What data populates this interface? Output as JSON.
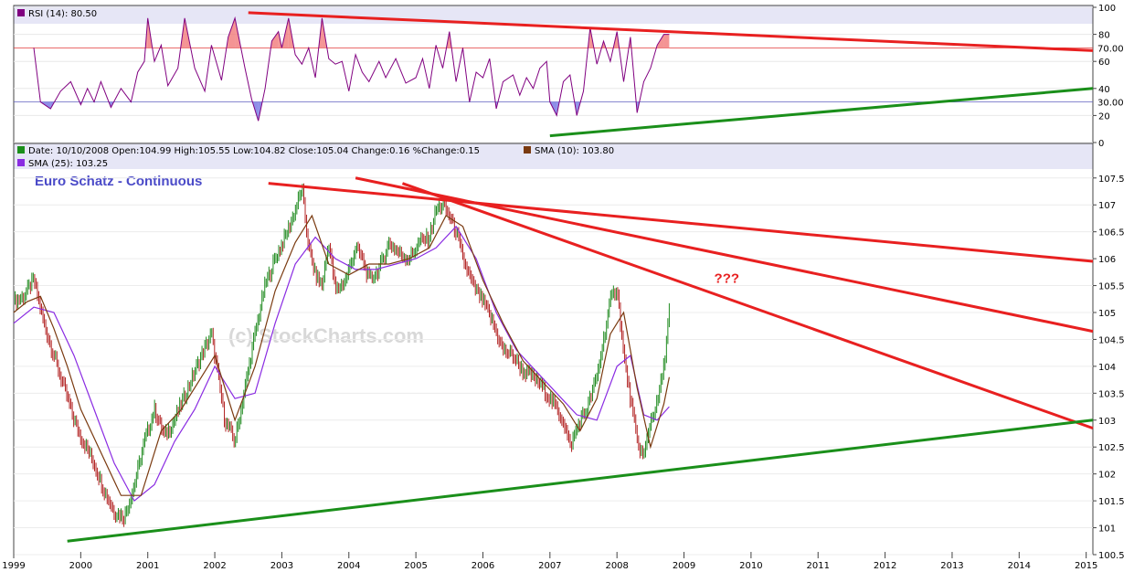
{
  "chart_data": [
    {
      "type": "line",
      "panel": "rsi",
      "legend": [
        {
          "label": "RSI (14): 80.50",
          "color": "#800080"
        }
      ],
      "ylim": [
        0,
        100
      ],
      "yticks": [
        0,
        20,
        40,
        60,
        80,
        100
      ],
      "overbought": {
        "label": "70.00",
        "value": 70,
        "color": "#e23a3a"
      },
      "oversold": {
        "label": "30.00",
        "value": 30,
        "color": "#6060c0"
      },
      "xlim": [
        1999.0,
        2015.1
      ],
      "series": [
        {
          "color": "#800080",
          "x": [
            1999.3,
            1999.4,
            1999.55,
            1999.7,
            1999.85,
            2000.0,
            2000.1,
            2000.2,
            2000.3,
            2000.45,
            2000.6,
            2000.75,
            2000.85,
            2000.95,
            2001.0,
            2001.1,
            2001.2,
            2001.3,
            2001.45,
            2001.55,
            2001.7,
            2001.85,
            2001.95,
            2002.1,
            2002.2,
            2002.3,
            2002.45,
            2002.55,
            2002.65,
            2002.75,
            2002.85,
            2002.95,
            2003.0,
            2003.1,
            2003.2,
            2003.3,
            2003.4,
            2003.5,
            2003.6,
            2003.7,
            2003.8,
            2003.9,
            2004.0,
            2004.1,
            2004.2,
            2004.3,
            2004.45,
            2004.55,
            2004.7,
            2004.85,
            2005.0,
            2005.1,
            2005.2,
            2005.3,
            2005.4,
            2005.5,
            2005.6,
            2005.7,
            2005.8,
            2005.9,
            2006.0,
            2006.1,
            2006.2,
            2006.3,
            2006.45,
            2006.55,
            2006.65,
            2006.75,
            2006.85,
            2006.95,
            2007.0,
            2007.1,
            2007.2,
            2007.3,
            2007.4,
            2007.5,
            2007.6,
            2007.7,
            2007.8,
            2007.9,
            2008.0,
            2008.1,
            2008.2,
            2008.3,
            2008.4,
            2008.5,
            2008.6,
            2008.7,
            2008.78
          ],
          "y": [
            70,
            30,
            25,
            38,
            45,
            28,
            40,
            30,
            45,
            26,
            40,
            30,
            52,
            60,
            92,
            60,
            72,
            42,
            55,
            92,
            55,
            38,
            72,
            46,
            78,
            92,
            55,
            32,
            16,
            40,
            75,
            82,
            70,
            92,
            65,
            58,
            70,
            48,
            92,
            62,
            58,
            60,
            38,
            65,
            52,
            45,
            60,
            48,
            62,
            44,
            48,
            62,
            40,
            72,
            55,
            82,
            45,
            70,
            30,
            52,
            48,
            62,
            25,
            45,
            50,
            35,
            48,
            40,
            55,
            60,
            30,
            20,
            45,
            50,
            20,
            38,
            85,
            58,
            75,
            60,
            82,
            45,
            78,
            22,
            45,
            55,
            72,
            80,
            80
          ]
        }
      ],
      "annotations": [
        {
          "type": "trendline",
          "color": "#e82020",
          "from": [
            2002.5,
            96
          ],
          "to": [
            2015.1,
            68
          ]
        },
        {
          "type": "trendline",
          "color": "#1a8f1a",
          "from": [
            2007.0,
            5
          ],
          "to": [
            2015.1,
            40
          ]
        }
      ]
    },
    {
      "type": "candlestick",
      "panel": "price",
      "title": "Euro Schatz - Continuous",
      "watermark": "(c) StockCharts.com",
      "legend": [
        {
          "label": "Date: 10/10/2008  Open:104.99  High:105.55  Low:104.82  Close:105.04  Change:0.16  %Change:0.15",
          "color": "#1a8f1a"
        },
        {
          "label": "SMA (10): 103.80",
          "color": "#7a3a10"
        },
        {
          "label": "SMA (25): 103.25",
          "color": "#8a2be2"
        }
      ],
      "ylim": [
        100.5,
        107.7
      ],
      "yticks": [
        100.5,
        101,
        101.5,
        102,
        102.5,
        103,
        103.5,
        104,
        104.5,
        105,
        105.5,
        106,
        106.5,
        107,
        107.5
      ],
      "xlim": [
        1999.0,
        2015.1
      ],
      "xticks": [
        "1999",
        "2000",
        "2001",
        "2002",
        "2003",
        "2004",
        "2005",
        "2006",
        "2007",
        "2008",
        "2009",
        "2010",
        "2011",
        "2012",
        "2013",
        "2014",
        "2015"
      ],
      "series": [
        {
          "name": "Price",
          "color": "#2a7a2a",
          "x": [
            1999.0,
            1999.15,
            1999.3,
            1999.45,
            1999.6,
            1999.75,
            1999.9,
            2000.0,
            2000.2,
            2000.35,
            2000.5,
            2000.65,
            2000.8,
            2000.95,
            2001.1,
            2001.25,
            2001.4,
            2001.6,
            2001.8,
            2001.95,
            2002.05,
            2002.15,
            2002.3,
            2002.45,
            2002.6,
            2002.75,
            2002.9,
            2003.05,
            2003.2,
            2003.3,
            2003.4,
            2003.5,
            2003.6,
            2003.7,
            2003.8,
            2003.95,
            2004.1,
            2004.2,
            2004.3,
            2004.45,
            2004.6,
            2004.75,
            2004.9,
            2005.05,
            2005.2,
            2005.3,
            2005.4,
            2005.5,
            2005.6,
            2005.7,
            2005.85,
            2006.0,
            2006.15,
            2006.3,
            2006.45,
            2006.6,
            2006.75,
            2006.9,
            2007.0,
            2007.1,
            2007.2,
            2007.3,
            2007.45,
            2007.55,
            2007.7,
            2007.8,
            2007.9,
            2008.0,
            2008.1,
            2008.2,
            2008.3,
            2008.4,
            2008.5,
            2008.6,
            2008.7,
            2008.78
          ],
          "y": [
            105.2,
            105.3,
            105.6,
            104.8,
            104.2,
            103.6,
            103.0,
            102.7,
            102.2,
            101.7,
            101.3,
            101.2,
            101.8,
            102.6,
            103.2,
            102.7,
            103.0,
            103.6,
            104.2,
            104.6,
            103.8,
            103.0,
            102.6,
            103.6,
            104.6,
            105.5,
            106.0,
            106.4,
            106.9,
            107.3,
            106.2,
            105.7,
            105.5,
            106.3,
            105.4,
            105.6,
            106.2,
            106.0,
            105.6,
            105.8,
            106.3,
            106.1,
            106.0,
            106.3,
            106.4,
            106.9,
            107.0,
            106.8,
            106.5,
            106.0,
            105.5,
            105.2,
            104.8,
            104.3,
            104.2,
            103.9,
            103.8,
            103.6,
            103.4,
            103.2,
            103.0,
            102.5,
            103.0,
            103.2,
            103.8,
            104.5,
            105.2,
            105.5,
            104.2,
            103.4,
            102.6,
            102.3,
            103.0,
            103.3,
            104.0,
            105.04
          ]
        },
        {
          "name": "SMA (10)",
          "color": "#7a3a10",
          "x": [
            1999.0,
            1999.2,
            1999.4,
            1999.6,
            1999.8,
            2000.0,
            2000.3,
            2000.6,
            2000.9,
            2001.2,
            2001.5,
            2001.8,
            2002.0,
            2002.3,
            2002.6,
            2002.9,
            2003.2,
            2003.45,
            2003.7,
            2004.0,
            2004.3,
            2004.6,
            2004.9,
            2005.2,
            2005.45,
            2005.7,
            2006.0,
            2006.3,
            2006.6,
            2006.9,
            2007.2,
            2007.45,
            2007.7,
            2007.9,
            2008.1,
            2008.3,
            2008.5,
            2008.7,
            2008.78
          ],
          "y": [
            105.0,
            105.2,
            105.3,
            104.7,
            104.0,
            103.2,
            102.4,
            101.6,
            101.6,
            102.8,
            103.2,
            103.8,
            104.2,
            103.0,
            104.0,
            105.4,
            106.3,
            106.8,
            105.9,
            105.7,
            105.9,
            105.9,
            106.0,
            106.2,
            106.8,
            106.6,
            105.6,
            104.8,
            104.1,
            103.7,
            103.3,
            102.8,
            103.4,
            104.6,
            105.0,
            103.6,
            102.5,
            103.3,
            103.8
          ]
        },
        {
          "name": "SMA (25)",
          "color": "#8a2be2",
          "x": [
            1999.0,
            1999.3,
            1999.6,
            1999.9,
            2000.2,
            2000.5,
            2000.8,
            2001.1,
            2001.4,
            2001.7,
            2002.0,
            2002.3,
            2002.6,
            2002.9,
            2003.2,
            2003.5,
            2003.8,
            2004.1,
            2004.4,
            2004.7,
            2005.0,
            2005.3,
            2005.6,
            2005.9,
            2006.2,
            2006.5,
            2006.8,
            2007.1,
            2007.4,
            2007.7,
            2008.0,
            2008.2,
            2008.4,
            2008.6,
            2008.78
          ],
          "y": [
            104.8,
            105.1,
            105.0,
            104.2,
            103.2,
            102.2,
            101.5,
            101.8,
            102.6,
            103.2,
            104.0,
            103.4,
            103.5,
            104.8,
            105.9,
            106.4,
            106.0,
            105.8,
            105.8,
            105.9,
            106.0,
            106.2,
            106.6,
            106.0,
            105.0,
            104.3,
            103.9,
            103.5,
            103.1,
            103.0,
            104.0,
            104.2,
            103.1,
            103.0,
            103.25
          ]
        }
      ],
      "annotations": [
        {
          "type": "trendline",
          "color": "#e82020",
          "from": [
            2002.8,
            107.4
          ],
          "to": [
            2015.1,
            105.95
          ]
        },
        {
          "type": "trendline",
          "color": "#e82020",
          "from": [
            2004.1,
            107.5
          ],
          "to": [
            2015.1,
            104.65
          ]
        },
        {
          "type": "trendline",
          "color": "#e82020",
          "from": [
            2004.8,
            107.4
          ],
          "to": [
            2015.1,
            102.85
          ]
        },
        {
          "type": "trendline",
          "color": "#1a8f1a",
          "from": [
            1999.8,
            100.75
          ],
          "to": [
            2015.1,
            103.0
          ]
        },
        {
          "type": "text",
          "text": "???",
          "color": "#e82020",
          "x": 2009.45,
          "y": 105.55
        }
      ]
    }
  ]
}
